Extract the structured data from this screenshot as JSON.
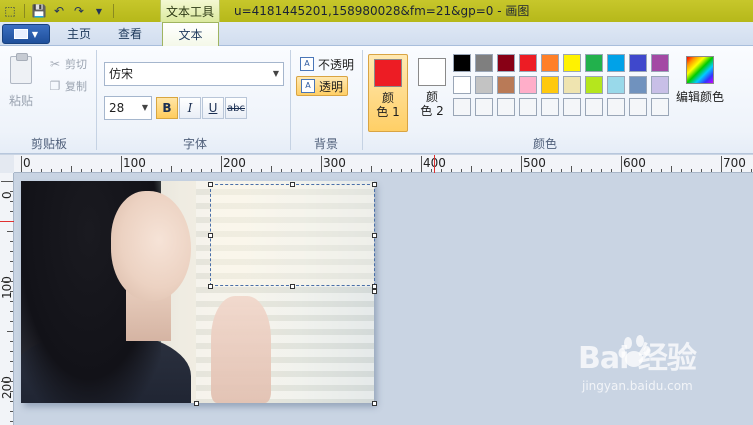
{
  "titlebar": {
    "context_tab": "文本工具",
    "title": "u=4181445201,158980028&fm=21&gp=0 - 画图"
  },
  "tabs": [
    {
      "label": "主页"
    },
    {
      "label": "查看"
    },
    {
      "label": "文本"
    }
  ],
  "clipboard": {
    "paste": "粘贴",
    "cut": "剪切",
    "copy": "复制",
    "group": "剪贴板"
  },
  "font": {
    "family": "仿宋",
    "size": "28",
    "bold": "B",
    "italic": "I",
    "underline": "U",
    "strikethrough": "abc",
    "group": "字体"
  },
  "background": {
    "opaque": "不透明",
    "transparent": "透明",
    "group": "背景"
  },
  "colors": {
    "color1_line1": "颜",
    "color1_line2": "色 1",
    "color2_line1": "颜",
    "color2_line2": "色 2",
    "edit_colors": "编辑颜色",
    "group": "颜色",
    "color1_value": "#ed1c24",
    "color2_value": "#ffffff",
    "palette": [
      "#000000",
      "#7f7f7f",
      "#880015",
      "#ed1c24",
      "#ff7f27",
      "#fff200",
      "#22b14c",
      "#00a2e8",
      "#3f48cc",
      "#a349a4",
      "#ffffff",
      "#c3c3c3",
      "#b97a57",
      "#ffaec9",
      "#ffc90e",
      "#efe4b0",
      "#b5e61d",
      "#99d9ea",
      "#7092be",
      "#c8bfe7",
      "#f4f6f9",
      "#f4f6f9",
      "#f4f6f9",
      "#f4f6f9",
      "#f4f6f9",
      "#f4f6f9",
      "#f4f6f9",
      "#f4f6f9",
      "#f4f6f9",
      "#f4f6f9"
    ]
  },
  "ruler": {
    "h_labels": [
      "0",
      "100",
      "200",
      "300",
      "400",
      "500",
      "600",
      "700"
    ],
    "v_labels": [
      "0",
      "100",
      "200"
    ]
  },
  "watermark": {
    "logo": "Bai 经验",
    "sub": "jingyan.baidu.com"
  }
}
